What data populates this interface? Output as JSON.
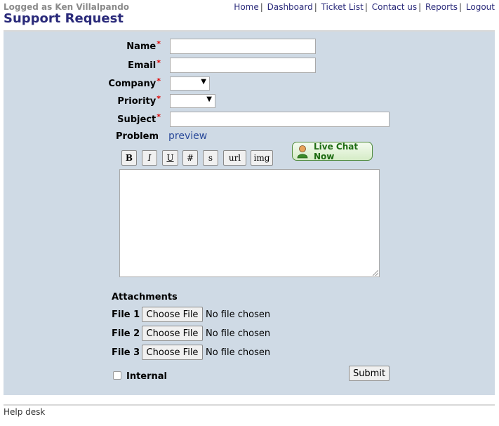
{
  "header": {
    "logged_as": "Logged as Ken Villalpando",
    "title": "Support Request",
    "nav": [
      "Home",
      "Dashboard",
      "Ticket List",
      "Contact us",
      "Reports",
      "Logout"
    ],
    "separator": "|"
  },
  "form": {
    "required_marker": "*",
    "name_label": "Name",
    "name_value": "",
    "email_label": "Email",
    "email_value": "",
    "company_label": "Company",
    "company_selected": "",
    "priority_label": "Priority",
    "priority_selected": "",
    "subject_label": "Subject",
    "subject_value": "",
    "problem_label": "Problem",
    "preview_link": "preview",
    "toolbar": [
      "B",
      "I",
      "U",
      "#",
      "s",
      "url",
      "img"
    ],
    "problem_text": "",
    "live_chat_label": "Live Chat Now",
    "attachments_label": "Attachments",
    "files": [
      {
        "label": "File 1",
        "button": "Choose File",
        "status": "No file chosen"
      },
      {
        "label": "File 2",
        "button": "Choose File",
        "status": "No file chosen"
      },
      {
        "label": "File 3",
        "button": "Choose File",
        "status": "No file chosen"
      }
    ],
    "internal_label": "Internal",
    "internal_checked": false,
    "submit_label": "Submit"
  },
  "footer": {
    "text": "Help desk"
  },
  "colors": {
    "panel_bg": "#cfdae5",
    "title": "#2a2a7a",
    "required": "#e00000",
    "chat_green": "#1d6b12"
  }
}
